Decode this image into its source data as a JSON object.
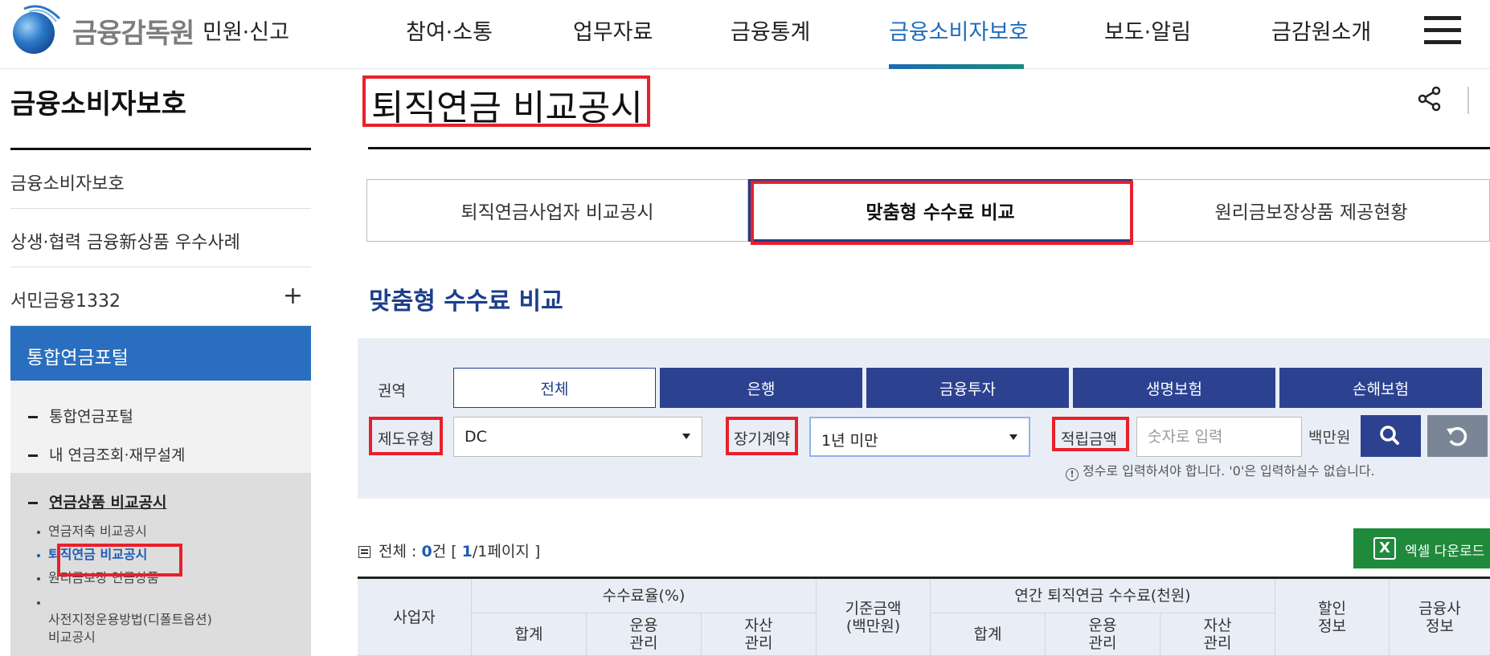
{
  "header": {
    "logo_text": "금융감독원",
    "nav": [
      "민원·신고",
      "참여·소통",
      "업무자료",
      "금융통계",
      "금융소비자보호",
      "보도·알림",
      "금감원소개"
    ],
    "active_index": 4
  },
  "sidebar": {
    "title": "금융소비자보호",
    "items": [
      "금융소비자보호",
      "상생·협력 금융新상품 우수사례",
      "서민금융1332"
    ],
    "expand_symbol": "+",
    "active": "통합연금포털",
    "sub_items": [
      "통합연금포털",
      "내 연금조회·재무설계",
      "연금상품 비교공시"
    ],
    "leaf_items": [
      "연금저축 비교공시",
      "퇴직연금 비교공시",
      "원리금보장 연금상품",
      "사전지정운용방법(디폴트옵션)\n비교공시"
    ],
    "current_leaf_index": 1
  },
  "main": {
    "title": "퇴직연금 비교공시",
    "tabs": [
      "퇴직연금사업자 비교공시",
      "맞춤형 수수료 비교",
      "원리금보장상품 제공현황"
    ],
    "active_tab": 1,
    "section_title": "맞춤형 수수료 비교"
  },
  "filter": {
    "region_label": "권역",
    "categories": [
      "전체",
      "은행",
      "금융투자",
      "생명보험",
      "손해보험"
    ],
    "selected_category": 0,
    "type_label": "제도유형",
    "type_value": "DC",
    "contract_label": "장기계약",
    "contract_value": "1년 미만",
    "amount_label": "적립금액",
    "amount_placeholder": "숫자로 입력",
    "amount_unit": "백만원",
    "notice": "정수로 입력하셔야 합니다. '0'은 입력하실수 없습니다."
  },
  "results": {
    "total_label": "전체 : ",
    "count": "0",
    "count_unit": "건 [ ",
    "page_current": "1",
    "page_rest": "/1페이지 ]",
    "excel_label": "엑셀 다운로드"
  },
  "table": {
    "headers": {
      "provider": "사업자",
      "fee_rate": "수수료율(%)",
      "base_amount": "기준금액\n(백만원)",
      "annual_fee": "연간 퇴직연금 수수료(천원)",
      "discount": "할인\n정보",
      "company": "금융사\n정보",
      "sum": "합계",
      "management": "운용\n관리",
      "asset": "자산\n관리"
    }
  },
  "colors": {
    "accent_blue": "#2c4290",
    "active_nav": "#1f6cbf",
    "highlight_red": "#e8202a",
    "excel_green": "#1f8a3b"
  },
  "icons": [
    "share-icon",
    "search-icon",
    "reset-icon",
    "hamburger-icon",
    "excel-icon",
    "info-icon",
    "list-icon"
  ]
}
